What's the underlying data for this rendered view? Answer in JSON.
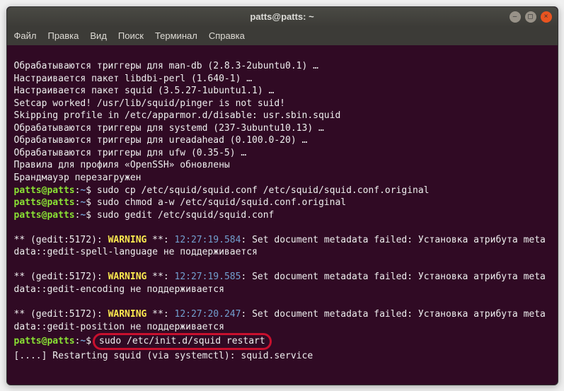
{
  "window": {
    "title": "patts@patts: ~"
  },
  "menu": {
    "file": "Файл",
    "edit": "Правка",
    "view": "Вид",
    "search": "Поиск",
    "terminal": "Терминал",
    "help": "Справка"
  },
  "lines": {
    "l0": "Обрабатываются триггеры для man-db (2.8.3-2ubuntu0.1) …",
    "l1": "Настраивается пакет libdbi-perl (1.640-1) …",
    "l2": "Настраивается пакет squid (3.5.27-1ubuntu1.1) …",
    "l3": "Setcap worked! /usr/lib/squid/pinger is not suid!",
    "l4": "Skipping profile in /etc/apparmor.d/disable: usr.sbin.squid",
    "l5": "Обрабатываются триггеры для systemd (237-3ubuntu10.13) …",
    "l6": "Обрабатываются триггеры для ureadahead (0.100.0-20) …",
    "l7": "Обрабатываются триггеры для ufw (0.35-5) …",
    "l8": "Правила для профиля «OpenSSH» обновлены",
    "l9": "Брандмауэр перезагружен",
    "p_user": "patts@patts",
    "p_sep1": ":",
    "p_path": "~",
    "p_sep2": "$ ",
    "cmd1": "sudo cp /etc/squid/squid.conf /etc/squid/squid.conf.original",
    "cmd2": "sudo chmod a-w /etc/squid/squid.conf.original",
    "cmd3": "sudo gedit /etc/squid/squid.conf",
    "w1a": "** (gedit:5172): ",
    "w1b": "WARNING",
    "w1c": " **: ",
    "w1t": "12:27:19.584",
    "w1d": ": Set document metadata failed: Установка атрибута metadata::gedit-spell-language не поддерживается",
    "w2t": "12:27:19.585",
    "w2d": ": Set document metadata failed: Установка атрибута metadata::gedit-encoding не поддерживается",
    "w3t": "12:27:20.247",
    "w3d": ": Set document metadata failed: Установка атрибута metadata::gedit-position не поддерживается",
    "cmd4": "sudo /etc/init.d/squid restart",
    "l_last": "[....] Restarting squid (via systemctl): squid.service"
  }
}
